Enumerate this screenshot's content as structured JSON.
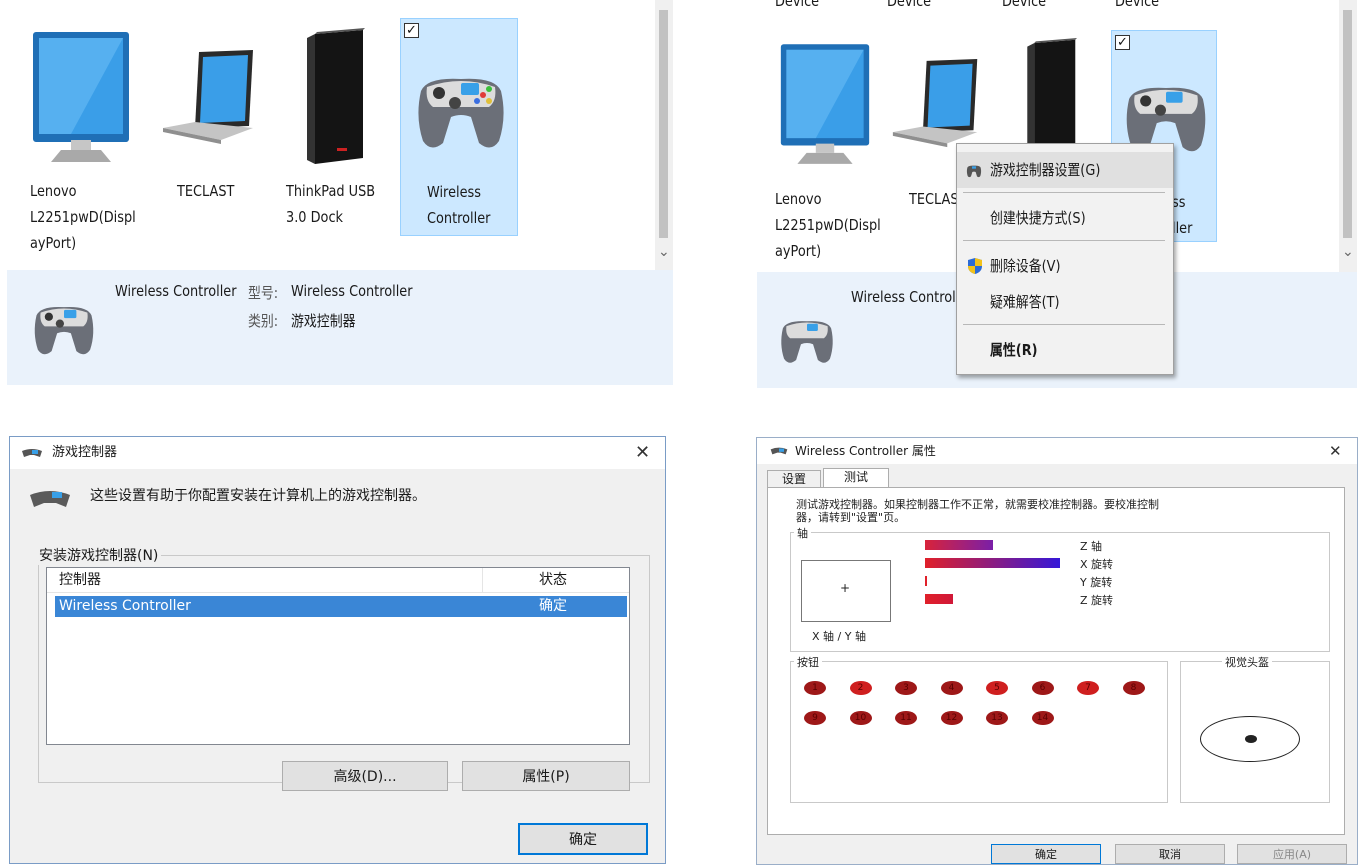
{
  "devices_panel": {
    "devices": [
      {
        "name": "Lenovo L2251pwD(DisplayPort)",
        "line1": "Lenovo",
        "line2": "L2251pwD(Displ",
        "line3": "ayPort)",
        "icon": "monitor-icon"
      },
      {
        "name": "TECLAST",
        "line1": "TECLAST",
        "icon": "laptop-icon"
      },
      {
        "name": "ThinkPad USB 3.0 Dock",
        "line1": "ThinkPad USB",
        "line2": "3.0 Dock",
        "icon": "dock-icon"
      },
      {
        "name": "Wireless Controller",
        "line1": "Wireless",
        "line2": "Controller",
        "icon": "gamepad-icon",
        "selected": true,
        "check": "✓"
      }
    ],
    "top_labels": [
      "Device",
      "Device",
      "Device",
      "Device"
    ],
    "scroll_arrow": "⌄",
    "info": {
      "device_name": "Wireless Controller",
      "model_key": "型号:",
      "model_value": "Wireless Controller",
      "category_key": "类别:",
      "category_value": "游戏控制器"
    },
    "info_partial": "Wireless Controll",
    "context_menu": {
      "items": [
        {
          "label": "游戏控制器设置(G)",
          "icon": "gamepad-small-icon",
          "highlighted": true
        },
        {
          "label": "创建快捷方式(S)"
        },
        {
          "label": "删除设备(V)",
          "icon": "shield-icon"
        },
        {
          "label": "疑难解答(T)"
        },
        {
          "label": "属性(R)",
          "bold": true
        }
      ]
    },
    "partial_labels": {
      "teclast": "TECLAST",
      "controller_a": "ss",
      "controller_b": "ller"
    }
  },
  "game_controllers_dialog": {
    "title": "游戏控制器",
    "close": "✕",
    "description": "这些设置有助于你配置安装在计算机上的游戏控制器。",
    "group_label": "安装游戏控制器(N)",
    "columns": [
      "控制器",
      "状态"
    ],
    "rows": [
      {
        "controller": "Wireless Controller",
        "status": "确定"
      }
    ],
    "buttons": {
      "advanced": "高级(D)...",
      "properties": "属性(P)",
      "ok": "确定"
    }
  },
  "properties_dialog": {
    "title": "Wireless Controller 属性",
    "close": "✕",
    "tabs": [
      "设置",
      "测试"
    ],
    "active_tab": 1,
    "instructions_1": "测试游戏控制器。如果控制器工作不正常，就需要校准控制器。要校准控制",
    "instructions_2": "器，请转到\"设置\"页。",
    "axes_group": "轴",
    "xy_label": "X 轴 / Y 轴",
    "crosshair": "+",
    "axes": [
      {
        "label": "Z 轴",
        "value": 0.5,
        "color_from": "#d8233a",
        "color_to": "#7a1fa8"
      },
      {
        "label": "X 旋转",
        "value": 1.0,
        "color_from": "#e0202a",
        "color_to": "#3518d8"
      },
      {
        "label": "Y 旋转",
        "value": 0.01,
        "color_from": "#e0202a",
        "color_to": "#e0202a"
      },
      {
        "label": "Z 旋转",
        "value": 0.21,
        "color_from": "#e0202a",
        "color_to": "#d01838"
      }
    ],
    "buttons_group": "按钮",
    "buttons_row1": [
      "1",
      "2",
      "3",
      "4",
      "5",
      "6",
      "7",
      "8"
    ],
    "buttons_row2": [
      "9",
      "10",
      "11",
      "12",
      "13",
      "14"
    ],
    "lit_buttons": [
      "2",
      "5",
      "7"
    ],
    "pov_group": "视觉头盔",
    "footer": {
      "ok": "确定",
      "cancel": "取消",
      "apply": "应用(A)"
    }
  }
}
